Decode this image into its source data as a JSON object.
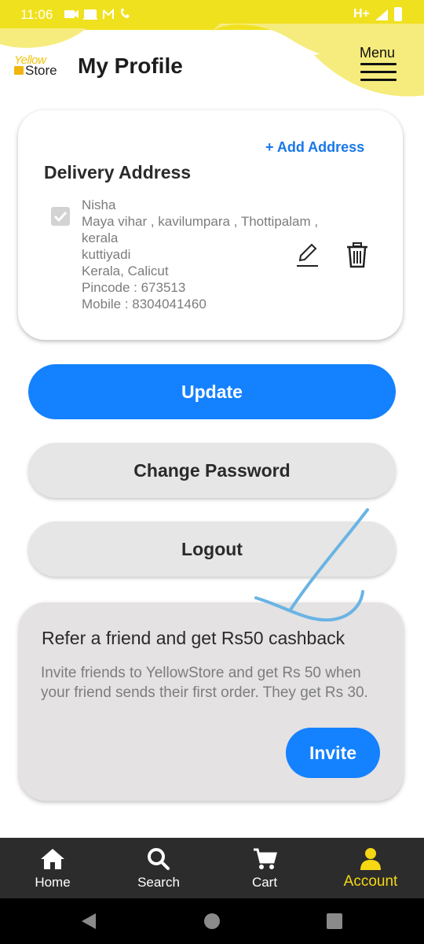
{
  "status_bar": {
    "time": "11:06",
    "network": "H+"
  },
  "header": {
    "logo_top": "Yellow",
    "logo_bottom": "Store",
    "title": "My Profile",
    "menu_label": "Menu"
  },
  "address_card": {
    "add_address": "+ Add Address",
    "heading": "Delivery Address",
    "lines": [
      "Nisha",
      "Maya vihar , kavilumpara , Thottipalam ,",
      "kerala",
      "kuttiyadi",
      "Kerala, Calicut",
      "Pincode : 673513",
      "Mobile : 8304041460"
    ]
  },
  "buttons": {
    "update": "Update",
    "change_password": "Change Password",
    "logout": "Logout"
  },
  "refer": {
    "title": "Refer a friend and get Rs50 cashback",
    "description": "Invite friends to YellowStore and get Rs 50 when your friend sends their first order. They get Rs 30.",
    "invite": "Invite"
  },
  "bottom_nav": {
    "items": [
      {
        "label": "Home",
        "icon": "home-icon"
      },
      {
        "label": "Search",
        "icon": "search-icon"
      },
      {
        "label": "Cart",
        "icon": "cart-icon"
      },
      {
        "label": "Account",
        "icon": "account-icon",
        "active": true
      }
    ]
  },
  "colors": {
    "brand_yellow": "#f0e11e",
    "primary_blue": "#1481ff",
    "active_nav": "#f5d714"
  }
}
